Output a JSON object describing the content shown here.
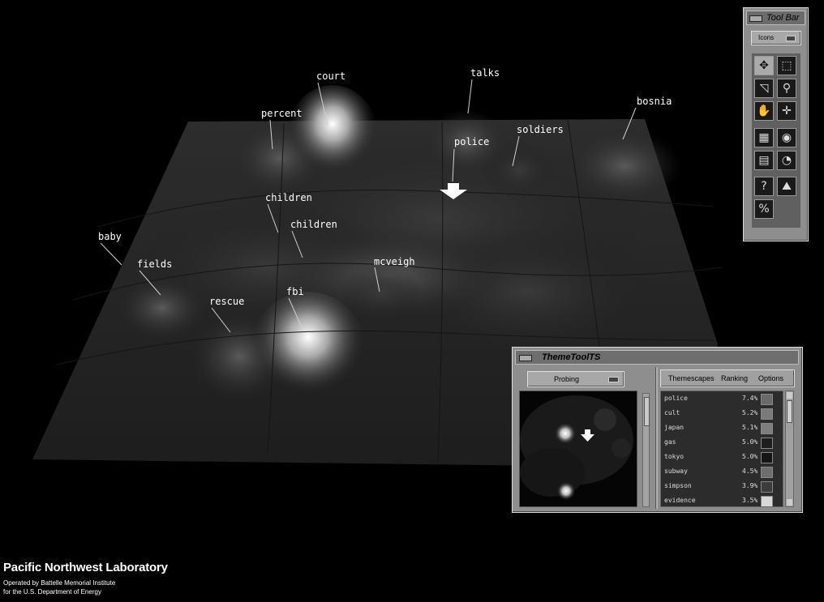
{
  "terrain_labels": {
    "court": "court",
    "talks": "talks",
    "bosnia": "bosnia",
    "percent": "percent",
    "soldiers": "soldiers",
    "police": "police",
    "children_1": "children",
    "children_2": "children",
    "baby": "baby",
    "fields": "fields",
    "mcveigh": "mcveigh",
    "rescue": "rescue",
    "fbi": "fbi"
  },
  "credits": {
    "title": "Pacific Northwest Laboratory",
    "line1": "Operated by Battelle Memorial Institute",
    "line2": "for the U.S. Department of Energy"
  },
  "toolbar": {
    "title": "Tool Bar",
    "mode": "Icons"
  },
  "themetool": {
    "title": "ThemeToolTS",
    "mode": "Probing",
    "menu": [
      "Themescapes",
      "Ranking",
      "Options"
    ],
    "ranking": [
      {
        "term": "police",
        "pct": "7.4%",
        "swatch": "#6a6a6a"
      },
      {
        "term": "cult",
        "pct": "5.2%",
        "swatch": "#7a7a7a"
      },
      {
        "term": "japan",
        "pct": "5.1%",
        "swatch": "#7e7e7e"
      },
      {
        "term": "gas",
        "pct": "5.0%",
        "swatch": "#1e1e1e"
      },
      {
        "term": "tokyo",
        "pct": "5.0%",
        "swatch": "#151515"
      },
      {
        "term": "subway",
        "pct": "4.5%",
        "swatch": "#6e6e6e"
      },
      {
        "term": "simpson",
        "pct": "3.9%",
        "swatch": "#3c3c3c"
      },
      {
        "term": "evidence",
        "pct": "3.5%",
        "swatch": "#d8d8d8"
      }
    ]
  },
  "colors": {
    "background": "#000000",
    "panel": "#8e8e8e",
    "label": "#ffffff"
  }
}
